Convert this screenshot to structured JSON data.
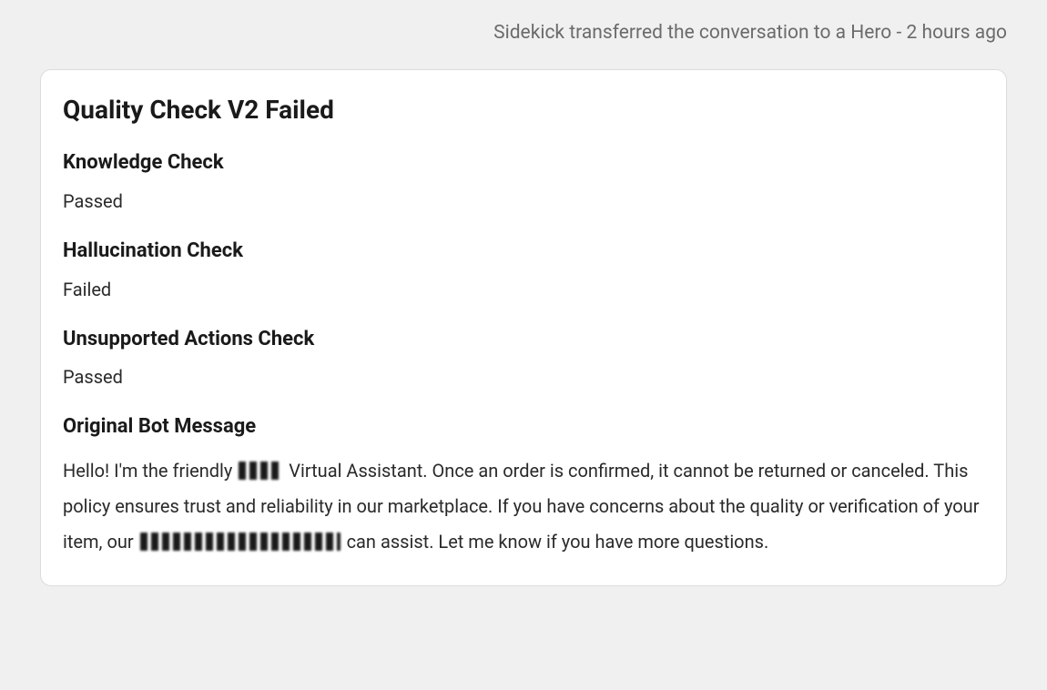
{
  "status": {
    "text": "Sidekick transferred the conversation to a Hero - 2 hours ago"
  },
  "card": {
    "title": "Quality Check V2 Failed",
    "sections": {
      "knowledge": {
        "heading": "Knowledge Check",
        "value": "Passed"
      },
      "hallucination": {
        "heading": "Hallucination Check",
        "value": "Failed"
      },
      "unsupported": {
        "heading": "Unsupported Actions Check",
        "value": "Passed"
      },
      "original": {
        "heading": "Original Bot Message",
        "body_part1": "Hello! I'm the friendly ",
        "body_part2": " Virtual Assistant. Once an order is confirmed, it cannot be returned or canceled. This policy ensures trust and reliability in our marketplace. If you have concerns about the quality or verification of your item, our ",
        "body_part3": " can assist. Let me know if you have more questions."
      }
    }
  }
}
